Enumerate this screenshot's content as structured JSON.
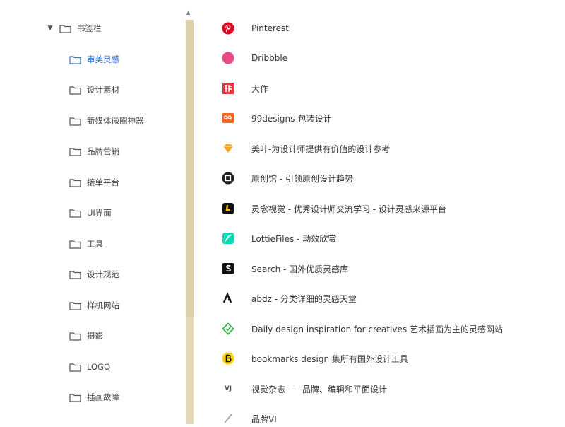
{
  "tree": {
    "root": {
      "label": "书签栏",
      "expanded": true
    },
    "folders": [
      {
        "label": "审美灵感",
        "selected": true
      },
      {
        "label": "设计素材"
      },
      {
        "label": "新媒体微圈神器"
      },
      {
        "label": "品牌营销"
      },
      {
        "label": "接单平台"
      },
      {
        "label": "UI界面"
      },
      {
        "label": "工具"
      },
      {
        "label": "设计规范"
      },
      {
        "label": "样机网站"
      },
      {
        "label": "摄影"
      },
      {
        "label": "LOGO"
      },
      {
        "label": "插画故障"
      }
    ]
  },
  "bookmarks": [
    {
      "title": "Pinterest",
      "icon": "pinterest-icon",
      "color": "#e60023"
    },
    {
      "title": "Dribbble",
      "icon": "dribbble-icon",
      "color": "#ea4c89"
    },
    {
      "title": "大作",
      "icon": "dazuo-icon",
      "color": "#e03a3e"
    },
    {
      "title": "99designs-包装设计",
      "icon": "99designs-icon",
      "color": "#f26522"
    },
    {
      "title": "美叶-为设计师提供有价值的设计参考",
      "icon": "meiye-icon",
      "color": "#f5a623"
    },
    {
      "title": "原创馆 - 引领原创设计趋势",
      "icon": "yuanchuang-icon",
      "color": "#222222"
    },
    {
      "title": "灵念视觉 - 优秀设计师交流学习 - 设计灵感来源平台",
      "icon": "lingnian-icon",
      "color": "#f3c300"
    },
    {
      "title": "LottieFiles - 动效欣赏",
      "icon": "lottiefiles-icon",
      "color": "#00ddb3"
    },
    {
      "title": "Search - 国外优质灵感库",
      "icon": "search-s-icon",
      "color": "#111111"
    },
    {
      "title": "abdz - 分类详细的灵感天堂",
      "icon": "abdz-icon",
      "color": "#111111"
    },
    {
      "title": "Daily design inspiration for creatives 艺术插画为主的灵感网站",
      "icon": "inspiration-icon",
      "color": "#3ab54a"
    },
    {
      "title": "bookmarks design 集所有国外设计工具",
      "icon": "bookmarks-b-icon",
      "color": "#ffd100"
    },
    {
      "title": "视觉杂志——品牌、编辑和平面设计",
      "icon": "vj-icon",
      "color": "#555555",
      "glyph": "VJ"
    },
    {
      "title": "品牌VI",
      "icon": "slash-icon",
      "color": "#999999"
    }
  ]
}
